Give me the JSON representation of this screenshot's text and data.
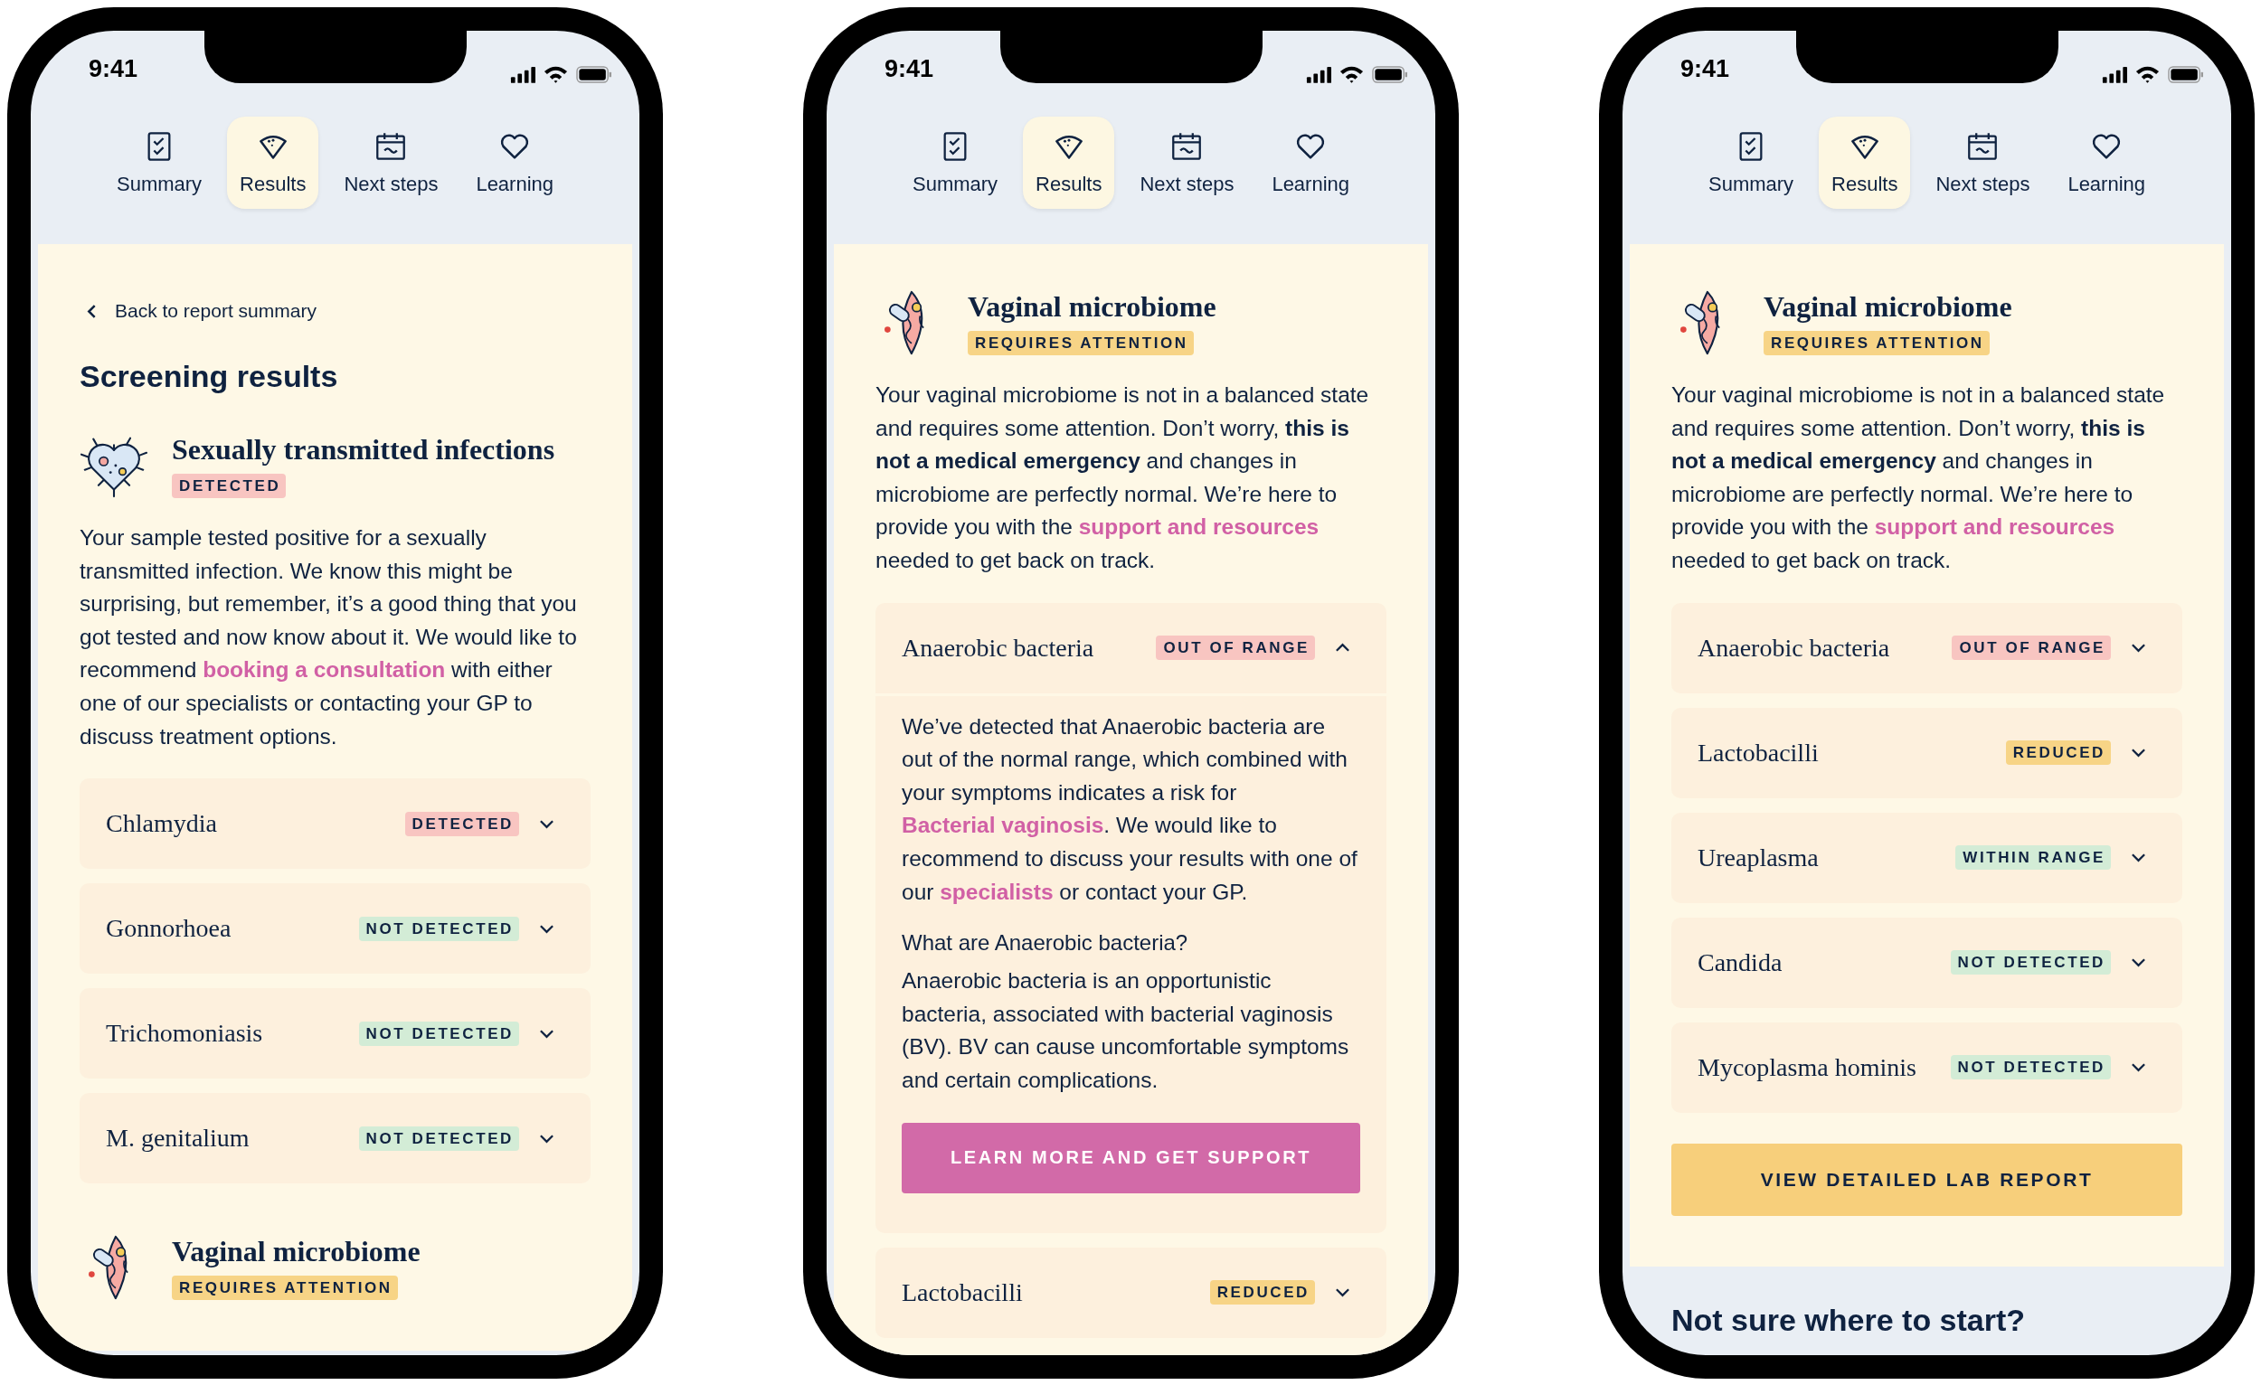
{
  "phones": [
    {
      "time": "9:41",
      "tabs": [
        {
          "label": "Summary",
          "selected": false
        },
        {
          "label": "Results",
          "selected": true
        },
        {
          "label": "Next steps",
          "selected": false
        },
        {
          "label": "Learning",
          "selected": false
        }
      ],
      "main": [
        {
          "kind": "back-link",
          "text": "Back to report summary"
        },
        {
          "kind": "heading",
          "text": "Screening results"
        },
        {
          "kind": "sti-section",
          "title": "Sexually transmitted infections",
          "badge": {
            "text": "DETECTED",
            "color": "#f8c5c1"
          },
          "paragraph": [
            {
              "text": "Your sample tested positive for a sexually transmitted infection. We know this might be surprising, but remember, it’s a good thing that you got tested and now know about it. We would like to recommend "
            },
            {
              "text": "booking a consultation",
              "link": true
            },
            {
              "text": " with either one of our specialists or contacting your GP to discuss treatment options."
            }
          ]
        },
        {
          "kind": "result",
          "name": "Chlamydia",
          "badge": {
            "text": "DETECTED",
            "color": "#f8c5c1"
          },
          "expanded": false
        },
        {
          "kind": "result",
          "name": "Gonnorhoea",
          "badge": {
            "text": "NOT DETECTED",
            "color": "#d3ecd6"
          },
          "expanded": false
        },
        {
          "kind": "result",
          "name": "Trichomoniasis",
          "badge": {
            "text": "NOT DETECTED",
            "color": "#d3ecd6"
          },
          "expanded": false
        },
        {
          "kind": "result",
          "name": "M. genitalium",
          "badge": {
            "text": "NOT DETECTED",
            "color": "#d3ecd6"
          },
          "expanded": false
        },
        {
          "kind": "microbiome-section",
          "title": "Vaginal microbiome",
          "badge": {
            "text": "REQUIRES ATTENTION",
            "color": "#f7d486"
          }
        }
      ]
    },
    {
      "time": "9:41",
      "tabs": [
        {
          "label": "Summary",
          "selected": false
        },
        {
          "label": "Results",
          "selected": true
        },
        {
          "label": "Next steps",
          "selected": false
        },
        {
          "label": "Learning",
          "selected": false
        }
      ],
      "main": [
        {
          "kind": "microbiome-section",
          "title": "Vaginal microbiome",
          "badge": {
            "text": "REQUIRES ATTENTION",
            "color": "#f7d486"
          },
          "paragraph": [
            {
              "text": "Your vaginal microbiome is not in a balanced state and requires some attention. Don’t worry, **this is not a medical emergency** and changes in microbiome are perfectly normal. We’re here to provide you with the "
            },
            {
              "text": "support and resources",
              "link": true
            },
            {
              "text": " needed to get back on track."
            }
          ]
        },
        {
          "kind": "result",
          "name": "Anaerobic bacteria",
          "badge": {
            "text": "OUT OF RANGE",
            "color": "#f8c5c1"
          },
          "expanded": true,
          "detail": [
            {
              "kind": "text",
              "segments": [
                {
                  "text": "We’ve detected that Anaerobic bacteria are out of the normal range, which combined with your symptoms indicates a risk for "
                },
                {
                  "text": "Bacterial vaginosis",
                  "link": true
                },
                {
                  "text": ". We would like to recommend to discuss your results with one of our "
                },
                {
                  "text": "specialists",
                  "link": true
                },
                {
                  "text": " or contact your GP."
                }
              ]
            },
            {
              "kind": "subheading",
              "text": "What are Anaerobic bacteria?"
            },
            {
              "kind": "text",
              "segments": [
                {
                  "text": "Anaerobic bacteria is an opportunistic bacteria, associated with bacterial vaginosis (BV). BV can cause uncomfortable symptoms and certain complications."
                }
              ]
            },
            {
              "kind": "cta",
              "text": "LEARN MORE AND GET SUPPORT"
            }
          ]
        },
        {
          "kind": "result",
          "name": "Lactobacilli",
          "badge": {
            "text": "REDUCED",
            "color": "#f7d486"
          },
          "expanded": false
        }
      ]
    },
    {
      "time": "9:41",
      "tabs": [
        {
          "label": "Summary",
          "selected": false
        },
        {
          "label": "Results",
          "selected": true
        },
        {
          "label": "Next steps",
          "selected": false
        },
        {
          "label": "Learning",
          "selected": false
        }
      ],
      "main": [
        {
          "kind": "microbiome-section",
          "title": "Vaginal microbiome",
          "badge": {
            "text": "REQUIRES ATTENTION",
            "color": "#f7d486"
          },
          "paragraph": [
            {
              "text": "Your vaginal microbiome is not in a balanced state and requires some attention. Don’t worry, **this is not a medical emergency** and changes in microbiome are perfectly normal. We’re here to provide you with the "
            },
            {
              "text": "support and resources",
              "link": true
            },
            {
              "text": " needed to get back on track."
            }
          ]
        },
        {
          "kind": "result",
          "name": "Anaerobic bacteria",
          "badge": {
            "text": "OUT OF RANGE",
            "color": "#f8c5c1"
          },
          "expanded": false
        },
        {
          "kind": "result",
          "name": "Lactobacilli",
          "badge": {
            "text": "REDUCED",
            "color": "#f7d486"
          },
          "expanded": false
        },
        {
          "kind": "result",
          "name": "Ureaplasma",
          "badge": {
            "text": "WITHIN RANGE",
            "color": "#d3ecd6"
          },
          "expanded": false
        },
        {
          "kind": "result",
          "name": "Candida",
          "badge": {
            "text": "NOT DETECTED",
            "color": "#d3ecd6"
          },
          "expanded": false
        },
        {
          "kind": "result",
          "name": "Mycoplasma hominis",
          "badge": {
            "text": "NOT DETECTED",
            "color": "#d3ecd6"
          },
          "expanded": false
        },
        {
          "kind": "lab-report-button",
          "text": "VIEW DETAILED LAB REPORT"
        }
      ],
      "footer": {
        "heading": "Not sure where to start?"
      }
    }
  ]
}
